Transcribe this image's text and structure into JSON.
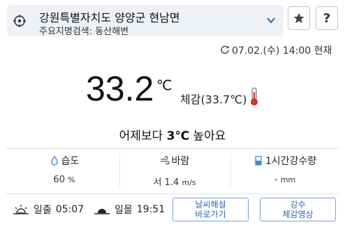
{
  "location": {
    "title": "강원특별자치도 양양군 현남면",
    "subtitle": "주요지명검색: 동산해변"
  },
  "buttons": {
    "help_label": "?",
    "favorite_icon": "star-icon",
    "sea_weather_line1": "날씨해설",
    "sea_weather_line2": "바로가기",
    "precip_line1": "강수",
    "precip_line2": "체감영상"
  },
  "observed": {
    "time": "07.02.(수) 14:00 현재"
  },
  "current": {
    "temperature": "33.2",
    "unit": "℃",
    "feels_like": "체감(33.7℃)"
  },
  "comparison": {
    "prefix": "어제보다 ",
    "delta": "3℃",
    "suffix": " 높아요"
  },
  "stats": {
    "humidity": {
      "label": "습도",
      "value": "60",
      "unit": "%"
    },
    "wind": {
      "label": "바람",
      "value": "서 1.4",
      "unit": "m/s"
    },
    "rain": {
      "label": "1시간강수량",
      "value": "-",
      "unit": "mm"
    }
  },
  "sun": {
    "sunrise_label": "일출",
    "sunrise_time": "05:07",
    "sunset_label": "일몰",
    "sunset_time": "19:51"
  },
  "colors": {
    "accent": "#2b64b8",
    "thermo_red": "#d9342b",
    "bar_bg": "#eef1f6"
  }
}
